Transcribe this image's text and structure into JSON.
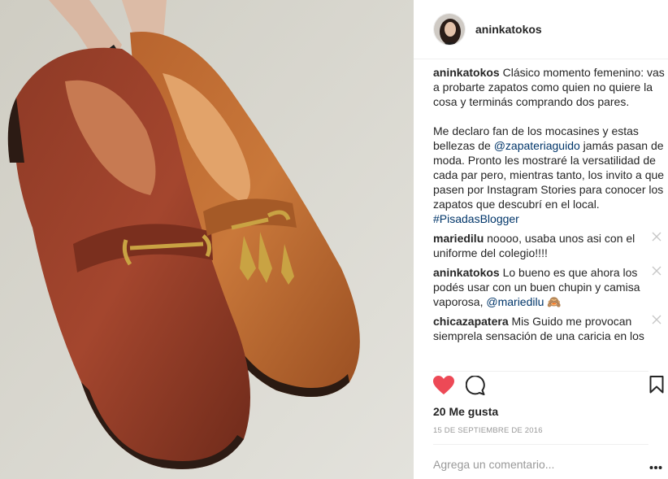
{
  "post": {
    "author": "aninkatokos",
    "caption": {
      "author": "aninkatokos",
      "text_part1": " Clásico momento femenino: vas a probarte zapatos como quien no quiere la cosa y terminás comprando dos pares.\n\nMe declaro fan de los mocasines y estas bellezas de ",
      "mention": "@zapateriaguido",
      "text_part2": " jamás pasan de moda. Pronto les mostraré la versatilidad de cada par pero, mientras tanto, los invito a que pasen por Instagram Stories para conocer los zapatos que descubrí en el local.",
      "hashtag": "#PisadasBlogger"
    },
    "comments": [
      {
        "user": "mariedilu",
        "text": " noooo, usaba unos asi con el uniforme del colegio!!!!"
      },
      {
        "user": "aninkatokos",
        "text": " Lo bueno es que ahora los podés usar con un buen chupin y camisa vaporosa, ",
        "mention": "@mariedilu",
        "emoji": " 🙈"
      },
      {
        "user": "chicazapatera",
        "text": " Mis Guido me provocan siemprela sensación de una caricia en los"
      }
    ],
    "likes": "20 Me gusta",
    "date": "15 de septiembre de 2016",
    "comment_placeholder": "Agrega un comentario...",
    "icons": {
      "like": "heart-icon",
      "comment": "comment-bubble-icon",
      "save": "bookmark-icon",
      "more": "more-options-icon",
      "delete": "close-icon"
    },
    "colors": {
      "like": "#ed4956",
      "link": "#003569",
      "muted": "#999999"
    }
  }
}
